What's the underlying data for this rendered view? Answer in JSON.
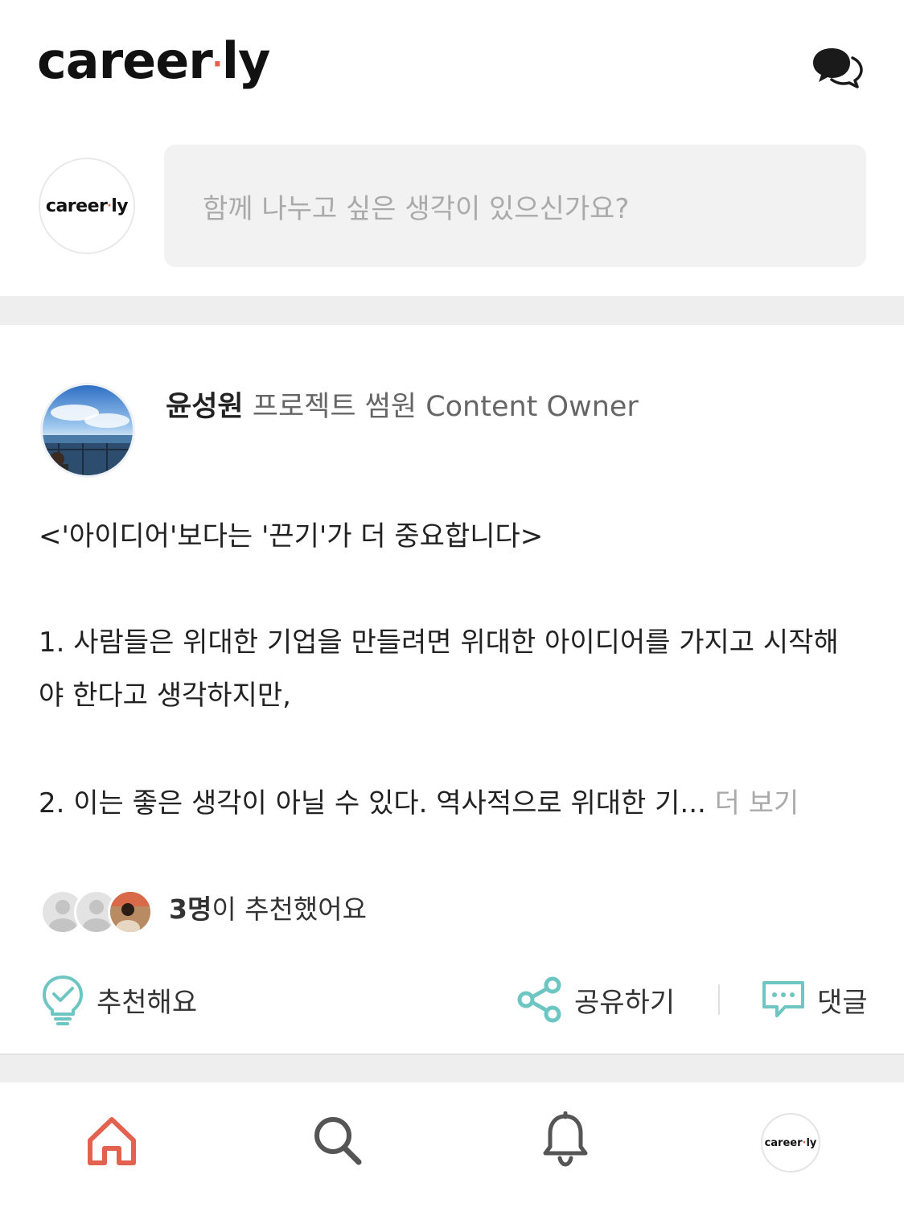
{
  "header": {
    "logo_left": "career",
    "logo_dot": "·",
    "logo_right": "ly",
    "chat_icon": "chat-bubbles-icon"
  },
  "composer": {
    "avatar_text_left": "career",
    "avatar_dot": "·",
    "avatar_text_right": "ly",
    "placeholder": "함께 나누고 싶은 생각이 있으신가요?"
  },
  "post": {
    "author_name": "윤성원",
    "author_title": "프로젝트 썸원 Content Owner",
    "title": "<'아이디어'보다는 '끈기'가 더 중요합니다>",
    "paragraph1_line1": "1. 사람들은 위대한 기업을 만들려면 위대한 아이디어를 가지고 시작해",
    "paragraph1_line2": "야 한다고 생각하지만,",
    "paragraph2": "2. 이는 좋은 생각이 아닐 수 있다. 역사적으로 위대한 기...",
    "more_label": "더 보기",
    "recommend_count": "3명",
    "recommend_suffix": "이 추천했어요",
    "actions": {
      "recommend": "추천해요",
      "share": "공유하기",
      "comment": "댓글"
    }
  },
  "bottom_nav": {
    "items": [
      "home-icon",
      "search-icon",
      "bell-icon",
      "profile-avatar"
    ],
    "profile_text_left": "career",
    "profile_dot": "·",
    "profile_text_right": "ly",
    "active_color": "#e2624f"
  }
}
